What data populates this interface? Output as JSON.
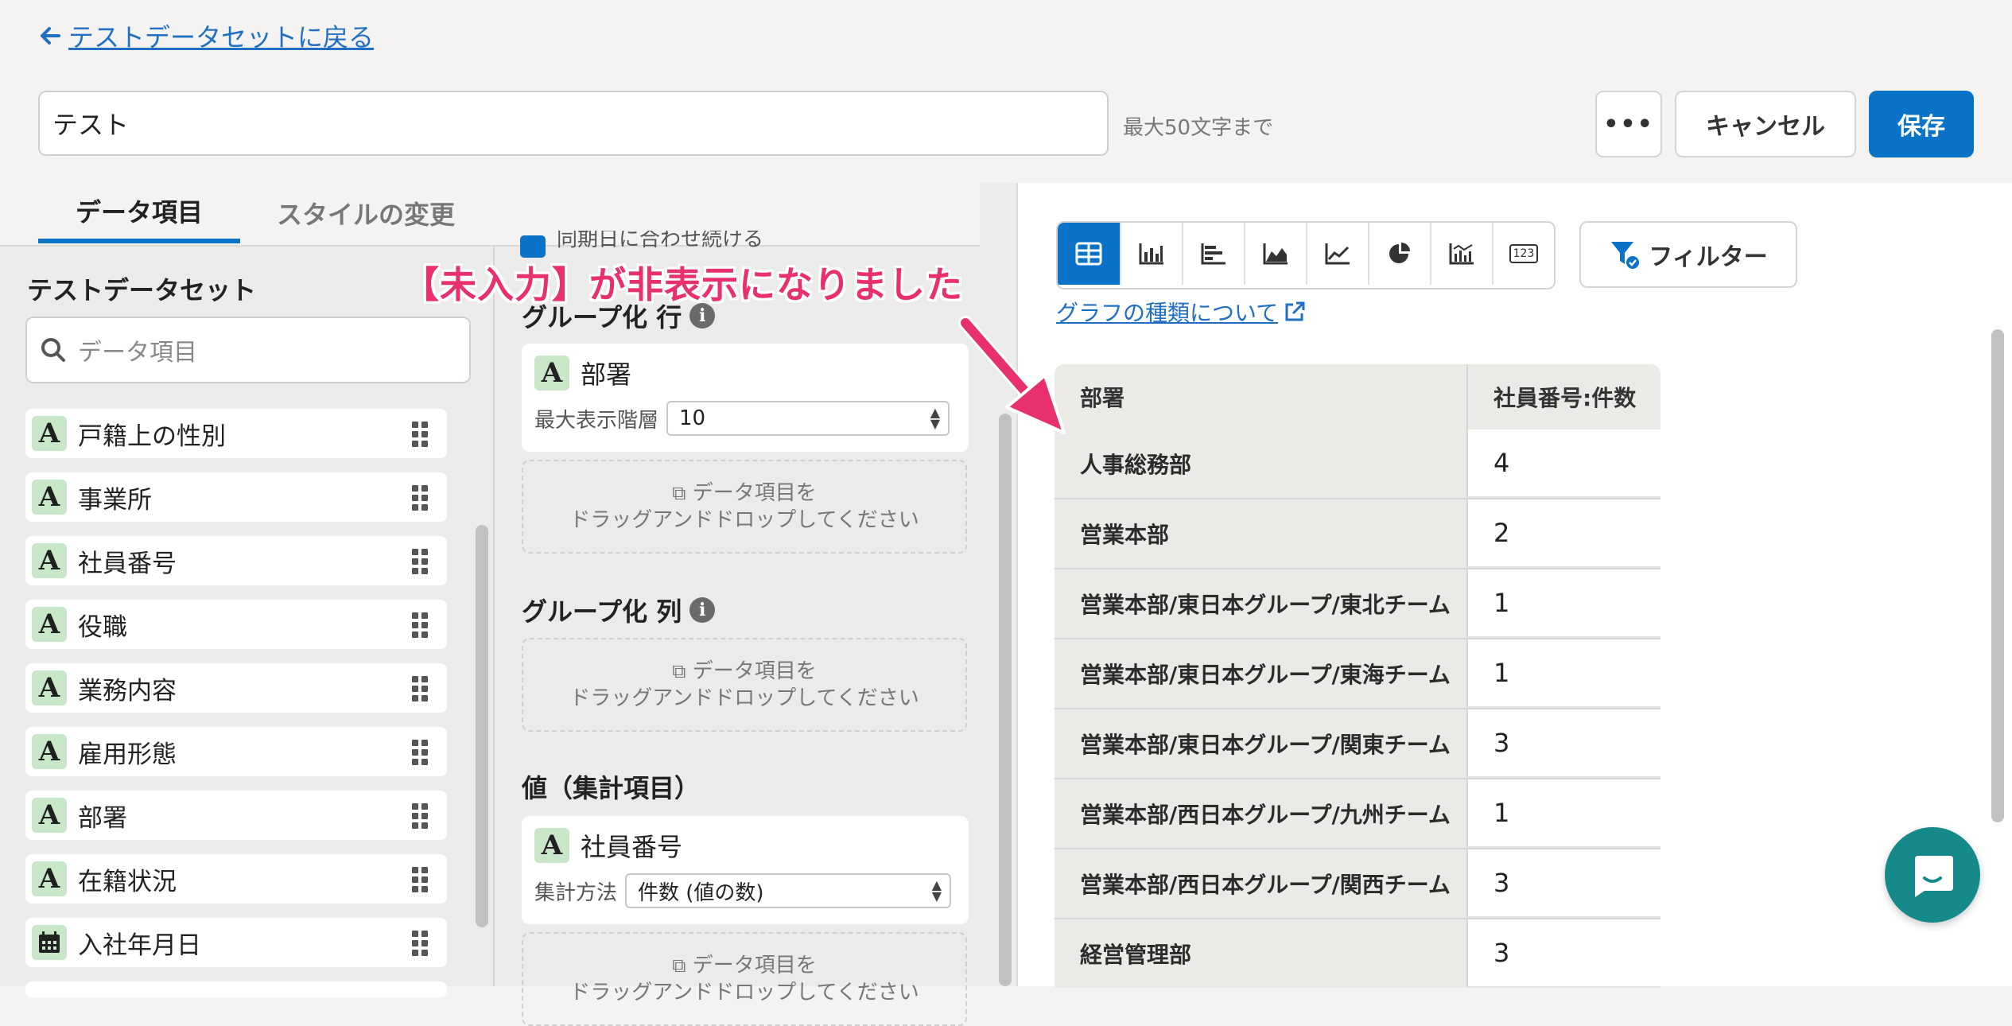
{
  "header": {
    "back_label": "テストデータセットに戻る",
    "title_value": "テスト",
    "char_limit_hint": "最大50文字まで",
    "more_label": "•••",
    "cancel_label": "キャンセル",
    "save_label": "保存"
  },
  "tabs": [
    {
      "label": "データ項目"
    },
    {
      "label": "スタイルの変更"
    }
  ],
  "sidebar": {
    "dataset_title": "テストデータセット",
    "search_placeholder": "データ項目",
    "items": [
      {
        "type": "A",
        "label": "戸籍上の性別"
      },
      {
        "type": "A",
        "label": "事業所"
      },
      {
        "type": "A",
        "label": "社員番号"
      },
      {
        "type": "A",
        "label": "役職"
      },
      {
        "type": "A",
        "label": "業務内容"
      },
      {
        "type": "A",
        "label": "雇用形態"
      },
      {
        "type": "A",
        "label": "部署"
      },
      {
        "type": "A",
        "label": "在籍状況"
      },
      {
        "type": "calendar",
        "label": "入社年月日"
      }
    ]
  },
  "config": {
    "top_check_text": "同期日に合わせ続ける",
    "group_row": {
      "title": "グループ化 行",
      "field_type": "A",
      "field_label": "部署",
      "depth_label": "最大表示階層",
      "depth_value": "10"
    },
    "dropzone_line1": "データ項目を",
    "dropzone_line2": "ドラッグアンドドロップしてください",
    "group_col": {
      "title": "グループ化 列"
    },
    "values": {
      "title": "値（集計項目）",
      "field_type": "A",
      "field_label": "社員番号",
      "agg_label": "集計方法",
      "agg_value": "件数 (値の数)"
    }
  },
  "chart": {
    "tab_icons": [
      "table-icon",
      "bar-chart-icon",
      "horizontal-bar-icon",
      "area-chart-icon",
      "line-chart-icon",
      "pie-chart-icon",
      "combo-chart-icon",
      "number-icon"
    ],
    "number_tab_label": "123",
    "filter_label": "フィルター",
    "help_link": "グラフの種類について"
  },
  "table": {
    "headers": [
      "部署",
      "社員番号:件数"
    ],
    "rows": [
      {
        "dept": "人事総務部",
        "count": "4"
      },
      {
        "dept": "営業本部",
        "count": "2"
      },
      {
        "dept": "営業本部/東日本グループ/東北チーム",
        "count": "1"
      },
      {
        "dept": "営業本部/東日本グループ/東海チーム",
        "count": "1"
      },
      {
        "dept": "営業本部/東日本グループ/関東チーム",
        "count": "3"
      },
      {
        "dept": "営業本部/西日本グループ/九州チーム",
        "count": "1"
      },
      {
        "dept": "営業本部/西日本グループ/関西チーム",
        "count": "3"
      },
      {
        "dept": "経営管理部",
        "count": "3"
      }
    ]
  },
  "annotation": {
    "text": "【未入力】が非表示になりました"
  },
  "colors": {
    "accent": "#0a73c8",
    "annotation": "#e8306f",
    "badge": "#c9e6c9",
    "chat": "#168a8a"
  }
}
